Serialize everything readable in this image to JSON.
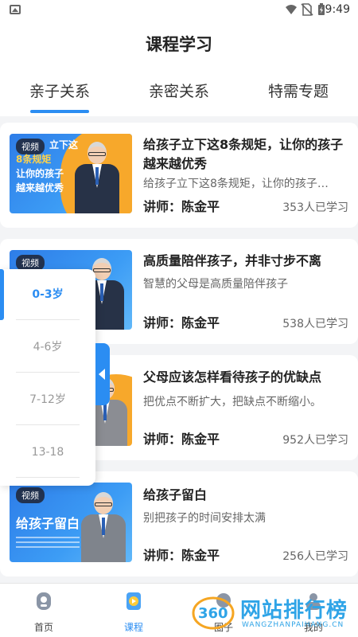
{
  "status_bar": {
    "time": "9:49"
  },
  "header": {
    "title": "课程学习"
  },
  "tabs": [
    {
      "label": "亲子关系",
      "active": true
    },
    {
      "label": "亲密关系",
      "active": false
    },
    {
      "label": "特需专题",
      "active": false
    }
  ],
  "courses": [
    {
      "badge": "视频",
      "thumb_text": [
        "立下这",
        "8条规矩",
        "让你的孩子",
        "越来越优秀"
      ],
      "title": "给孩子立下这8条规矩，让你的孩子越来越优秀",
      "desc": "给孩子立下这8条规矩，让你的孩子…",
      "teacher": "讲师：陈金平",
      "count": "353人已学习"
    },
    {
      "badge": "视频",
      "title": "高质量陪伴孩子，并非寸步不离",
      "desc": "智慧的父母是高质量陪伴孩子",
      "teacher": "讲师：陈金平",
      "count": "538人已学习"
    },
    {
      "title": "父母应该怎样看待孩子的优缺点",
      "desc": "把优点不断扩大，把缺点不断缩小。",
      "teacher": "讲师：陈金平",
      "count": "952人已学习"
    },
    {
      "badge": "视频",
      "thumb_text": [
        "给孩子留白"
      ],
      "title": "给孩子留白",
      "desc": "别把孩子的时间安排太满",
      "teacher": "讲师：陈金平",
      "count": "256人已学习"
    }
  ],
  "age_filter": {
    "items": [
      "0-3岁",
      "4-6岁",
      "7-12岁",
      "13-18"
    ],
    "selected": "0-3岁"
  },
  "bottom_nav": [
    {
      "label": "首页",
      "icon": "home-icon",
      "active": false
    },
    {
      "label": "课程",
      "icon": "course-icon",
      "active": true
    },
    {
      "label": "圈子",
      "icon": "circle-icon",
      "active": false
    },
    {
      "label": "我的",
      "icon": "profile-icon",
      "active": false
    }
  ],
  "watermark": {
    "logo": "360",
    "text": "网站排行榜",
    "sub": "WANGZHANPAIHANG.CN"
  },
  "colors": {
    "accent": "#2b8df2",
    "thumb_orange": "#f7a82b",
    "thumb_blue": "#2e7de8"
  }
}
